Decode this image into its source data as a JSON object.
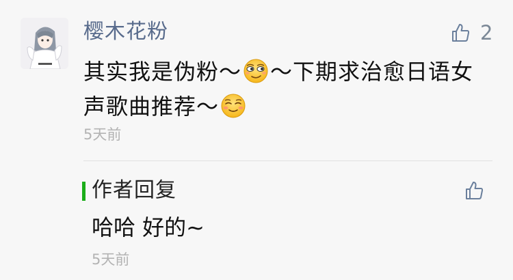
{
  "comment": {
    "nickname": "樱木花粉",
    "like_count": "2",
    "text_part1": "其实我是伪粉～",
    "text_part2": "～下期求治愈日语女声歌曲推荐～",
    "emoji_1": "smirk-emoji",
    "emoji_2": "relieved-smile-emoji",
    "time": "5天前"
  },
  "reply": {
    "label": "作者回复",
    "text": "哈哈 好的~",
    "time": "5天前"
  },
  "colors": {
    "nickname": "#586b8c",
    "accent_green": "#1aad19",
    "muted": "#b3b3b3",
    "background": "#f7f7f7"
  }
}
